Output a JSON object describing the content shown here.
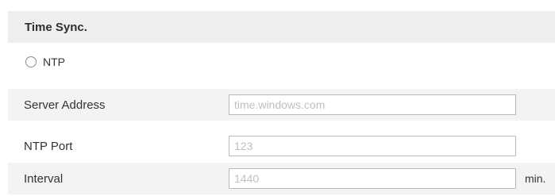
{
  "section": {
    "title": "Time Sync."
  },
  "ntp": {
    "radio_label": "NTP",
    "server_address": {
      "label": "Server Address",
      "value": "time.windows.com"
    },
    "ntp_port": {
      "label": "NTP Port",
      "value": "123"
    },
    "interval": {
      "label": "Interval",
      "value": "1440",
      "unit": "min."
    }
  },
  "colors": {
    "header_background": "#eeeeee",
    "alt_row_background": "#f3f3f3",
    "input_border": "#b7b7b7",
    "input_text": "#bfbfbf"
  }
}
